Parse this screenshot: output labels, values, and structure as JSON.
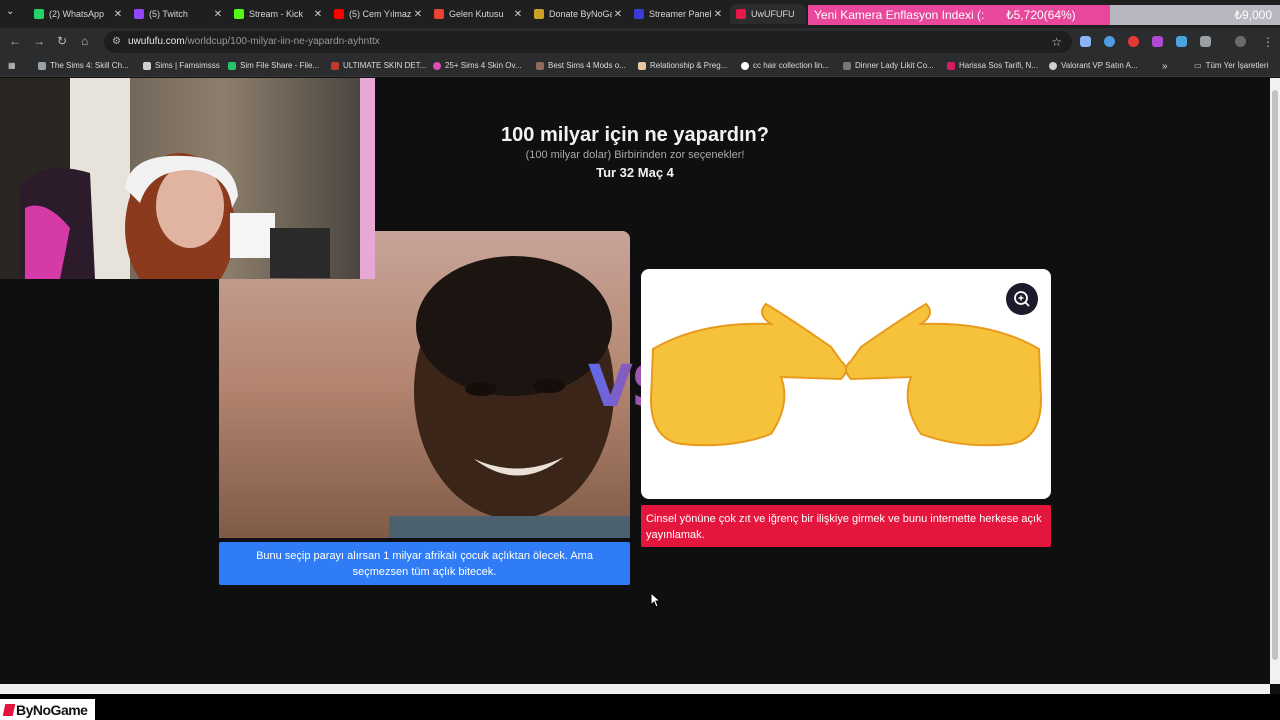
{
  "browser": {
    "tabs": [
      {
        "label": "(2) WhatsApp",
        "color": "#25d366"
      },
      {
        "label": "(5) Twitch",
        "color": "#9146ff"
      },
      {
        "label": "Stream - Kick",
        "color": "#53fc18"
      },
      {
        "label": "(5) Cem Yılmaz",
        "color": "#ff0000"
      },
      {
        "label": "Gelen Kutusu",
        "color": "#ea4335"
      },
      {
        "label": "Donate ByNoGame",
        "color": "#c9a227"
      },
      {
        "label": "Streamer Panel",
        "color": "#3b3bd6"
      },
      {
        "label": "UwUFUFU",
        "color": "#e8174a"
      }
    ],
    "url_domain": "uwufufu.com",
    "url_path": "/worldcup/100-milyar-iin-ne-yapardn-ayhnttx",
    "bookmarks": [
      "The Sims 4: Skill Ch...",
      "Sims | Famsimsss",
      "Sim File Share - File...",
      "ULTIMATE SKIN DET...",
      "25+ Sims 4 Skin Ov...",
      "Best Sims 4 Mods o...",
      "Relationship & Preg...",
      "cc hair collection lin...",
      "Dinner Lady Likit Co...",
      "Harissa Sos Tarifi, N...",
      "Valorant VP Satın A..."
    ],
    "bookmarks_folder": "Tüm Yer İşaretleri",
    "more_bookmarks": "»"
  },
  "donation_overlay": {
    "label": "Yeni Kamera Enflasyon Indexi (:",
    "current": "₺5,720(64%)",
    "goal": "₺9,000",
    "progress": 0.64,
    "fill_color": "#e8479b"
  },
  "page": {
    "title": "100 milyar için ne yapardın?",
    "subtitle": "(100 milyar dolar) Birbirinden zor seçenekler!",
    "round": "Tur 32 Maç 4",
    "vs": "VS",
    "left_option": {
      "description": "Bunu seçip parayı alırsan 1 milyar afrikalı çocuk açlıktan ölecek. Ama seçmezsen tüm açlık bitecek.",
      "color": "#2f7cf6"
    },
    "right_option": {
      "description": "Cinsel yönüne çok zıt ve iğrenç bir ilişkiye girmek ve bunu internette herkese açık yayınlamak.",
      "color": "#e5163d",
      "zoom_icon": "magnifier-plus-icon"
    }
  },
  "stream_logo": "ByNoGame"
}
